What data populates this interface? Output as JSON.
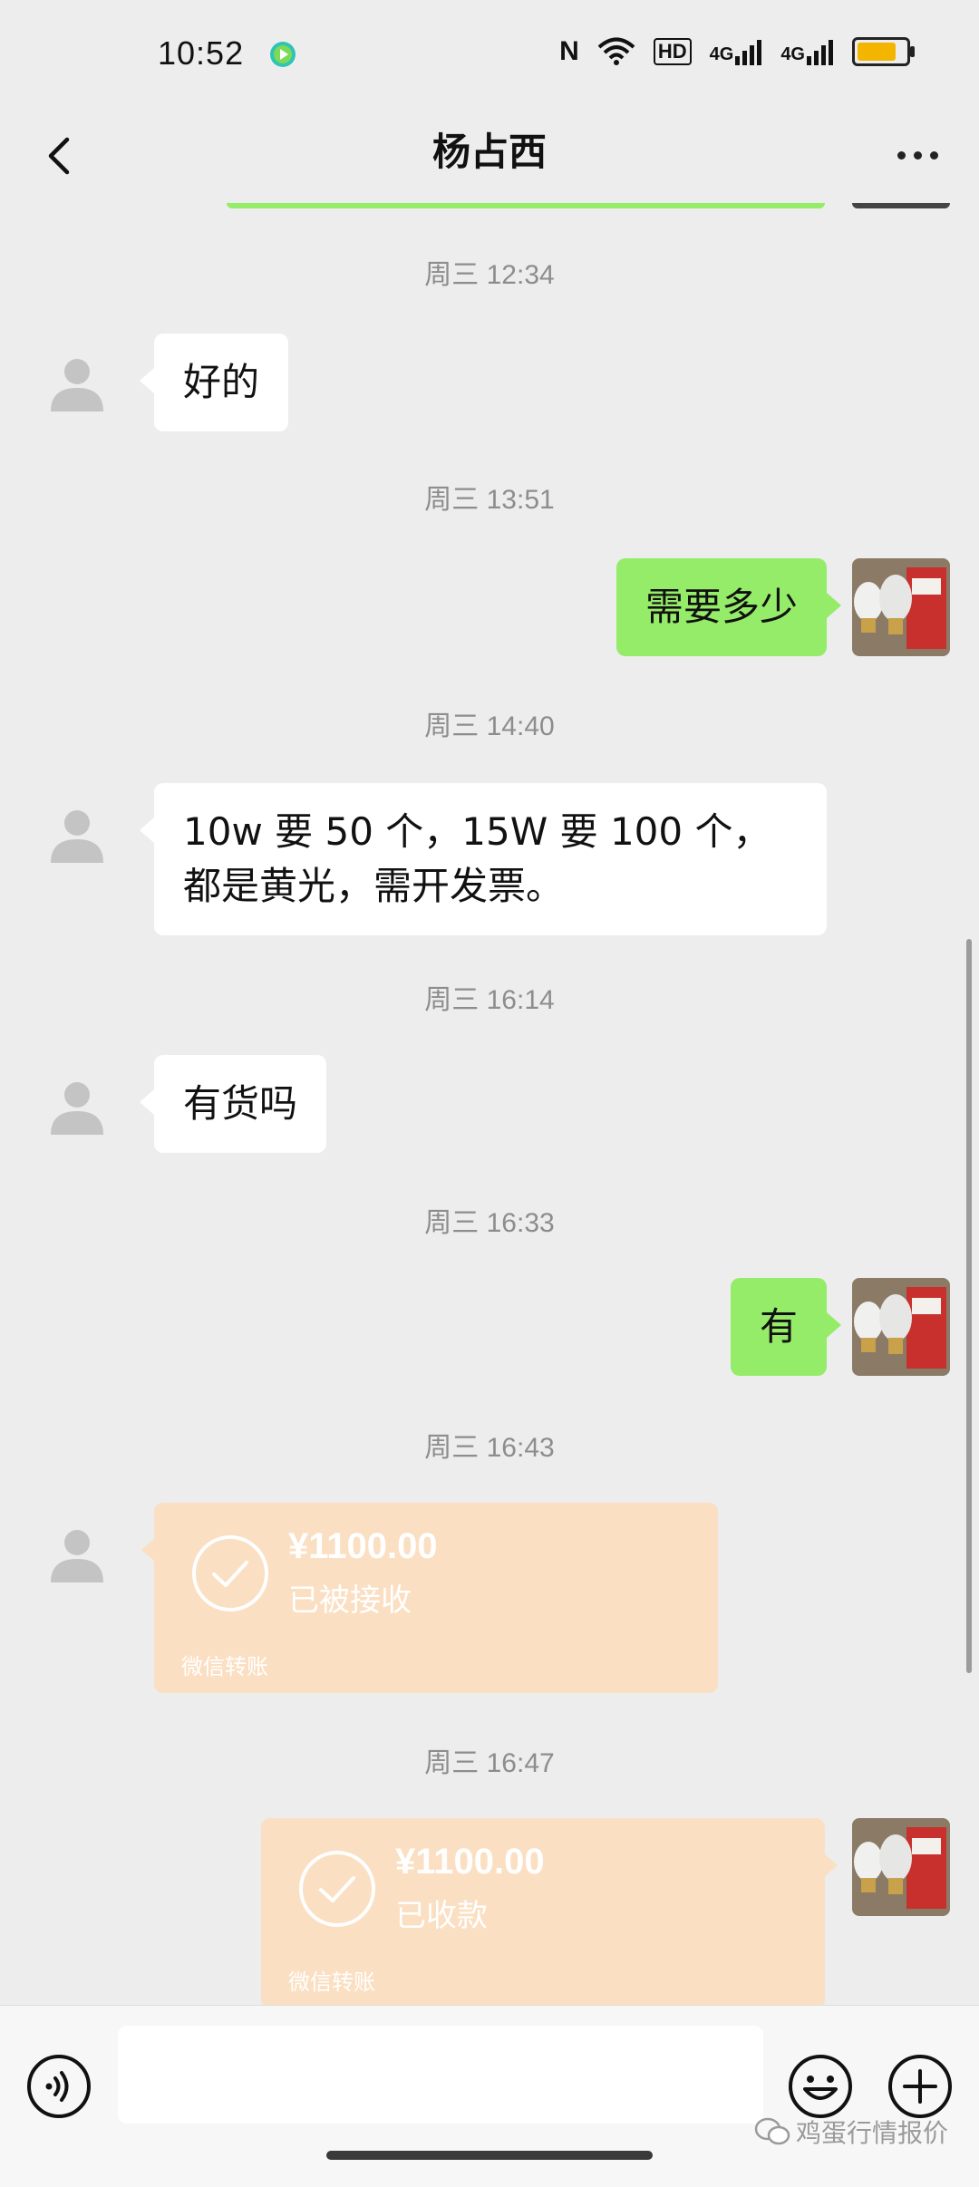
{
  "status_bar": {
    "time": "10:52",
    "icons": [
      "nfc-icon",
      "wifi-icon",
      "hd-icon",
      "signal-4g-icon",
      "signal-4g-icon",
      "battery-icon"
    ],
    "nfc": "N",
    "hd": "HD",
    "net1": "4G",
    "net2": "4G",
    "battery_level": 0.8
  },
  "header": {
    "title": "杨占西",
    "back_icon": "chevron-left-icon",
    "more_icon": "more-dots-icon"
  },
  "messages": [
    {
      "type": "time",
      "text": "周三 12:34"
    },
    {
      "type": "text",
      "side": "left",
      "text": "好的"
    },
    {
      "type": "time",
      "text": "周三 13:51"
    },
    {
      "type": "text",
      "side": "right",
      "text": "需要多少"
    },
    {
      "type": "time",
      "text": "周三 14:40"
    },
    {
      "type": "text",
      "side": "left",
      "text": "10w 要 50 个，15W 要 100 个，都是黄光，需开发票。"
    },
    {
      "type": "time",
      "text": "周三 16:14"
    },
    {
      "type": "text",
      "side": "left",
      "text": "有货吗"
    },
    {
      "type": "time",
      "text": "周三 16:33"
    },
    {
      "type": "text",
      "side": "right",
      "text": "有"
    },
    {
      "type": "time",
      "text": "周三 16:43"
    },
    {
      "type": "transfer",
      "side": "left",
      "amount": "¥1100.00",
      "status": "已被接收",
      "label": "微信转账"
    },
    {
      "type": "time",
      "text": "周三 16:47"
    },
    {
      "type": "transfer",
      "side": "right",
      "amount": "¥1100.00",
      "status": "已收款",
      "label": "微信转账"
    }
  ],
  "input_bar": {
    "voice_icon": "voice-icon",
    "placeholder": "",
    "emoji_icon": "emoji-icon",
    "plus_icon": "plus-icon"
  },
  "watermark": {
    "text": "鸡蛋行情报价",
    "icon": "wechat-logo-icon"
  },
  "colors": {
    "background": "#ededed",
    "bubble_self": "#95ec69",
    "bubble_other": "#ffffff",
    "transfer_received": "#fbdfc2",
    "timestamp": "#8d8d8d"
  }
}
